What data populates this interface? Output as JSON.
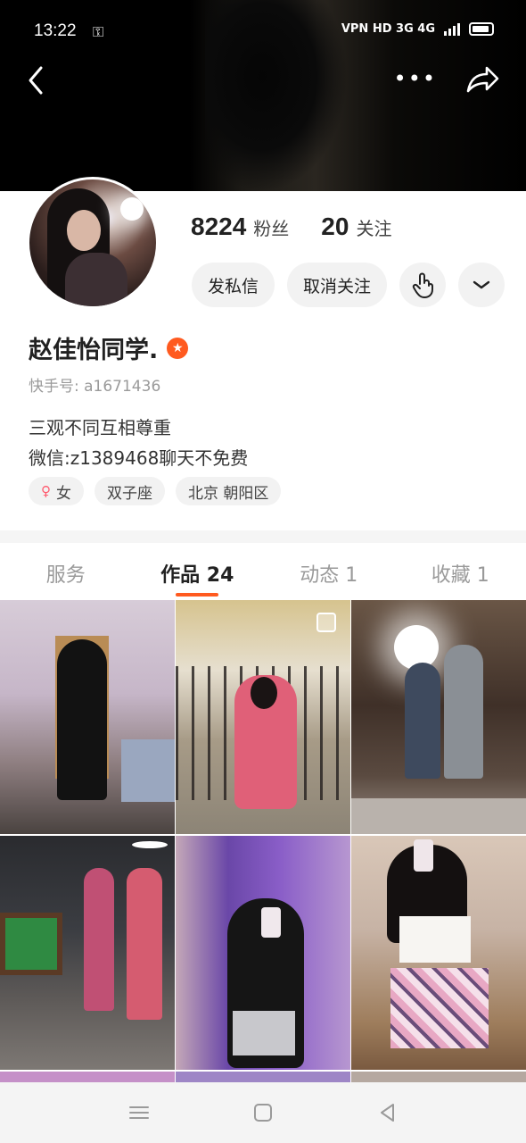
{
  "status_bar": {
    "time": "13:22",
    "key_icon": "key-icon",
    "network_text": "VPN HD 3G 4G"
  },
  "header": {
    "back_icon": "chevron-left-icon",
    "more_icon": "more-dots-icon",
    "share_icon": "share-arrow-icon"
  },
  "profile": {
    "fans_count": "8224",
    "fans_label": "粉丝",
    "following_count": "20",
    "following_label": "关注",
    "message_button": "发私信",
    "unfollow_button": "取消关注",
    "name": "赵佳怡同学.",
    "badge_icon": "star-badge-icon",
    "uid": "快手号: a1671436",
    "bio_line1": "三观不同互相尊重",
    "bio_line2": "微信:z1389468聊天不免费",
    "tags": [
      "女",
      "双子座",
      "北京 朝阳区"
    ]
  },
  "tabs": [
    "服务",
    "作品 24",
    "动态 1",
    "收藏 1"
  ],
  "active_tab": "作品 24",
  "colors": {
    "accent": "#ff5a1f",
    "pill_bg": "#f2f2f2",
    "muted_text": "#9a9a9a"
  }
}
